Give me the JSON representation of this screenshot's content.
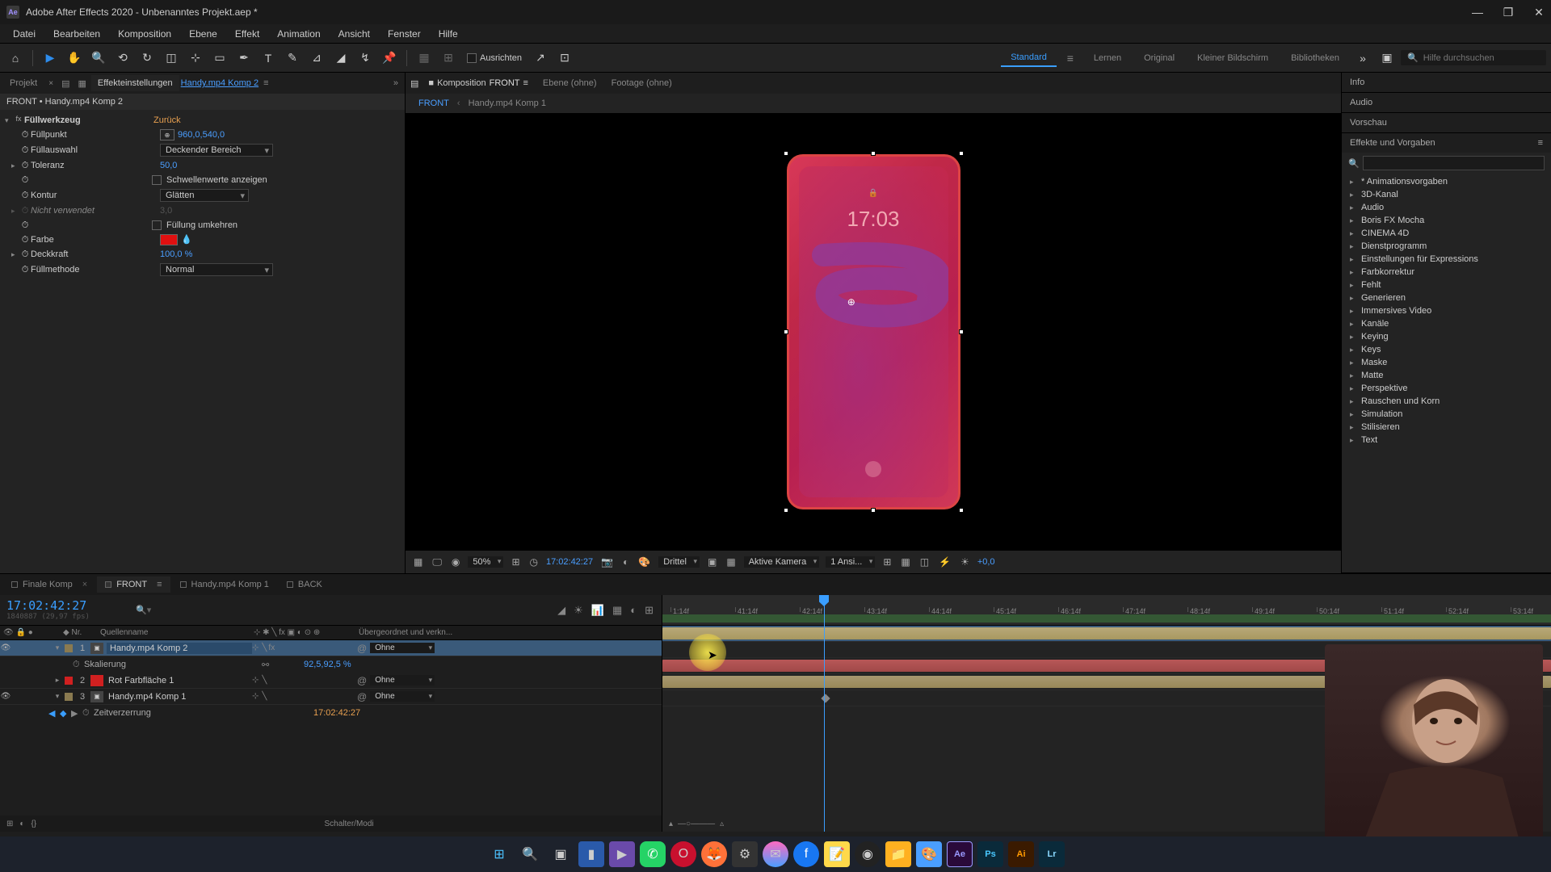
{
  "titlebar": {
    "app": "Adobe After Effects 2020",
    "project": "Unbenanntes Projekt.aep *"
  },
  "menu": [
    "Datei",
    "Bearbeiten",
    "Komposition",
    "Ebene",
    "Effekt",
    "Animation",
    "Ansicht",
    "Fenster",
    "Hilfe"
  ],
  "toolbar": {
    "align": "Ausrichten",
    "workspaces": [
      "Standard",
      "Lernen",
      "Original",
      "Kleiner Bildschirm",
      "Bibliotheken"
    ],
    "active_ws": "Standard",
    "search_placeholder": "Hilfe durchsuchen"
  },
  "left_panel": {
    "tabs": {
      "projekt": "Projekt",
      "settings": "Effekteinstellungen",
      "target": "Handy.mp4 Komp 2"
    },
    "breadcrumb": "FRONT • Handy.mp4 Komp 2",
    "effect_name": "Füllwerkzeug",
    "reset": "Zurück",
    "props": {
      "fuellpunkt": {
        "label": "Füllpunkt",
        "value": "960,0,540,0"
      },
      "fuellauswahl": {
        "label": "Füllauswahl",
        "value": "Deckender Bereich"
      },
      "toleranz": {
        "label": "Toleranz",
        "value": "50,0"
      },
      "schwellen": {
        "label": "Schwellenwerte anzeigen"
      },
      "kontur": {
        "label": "Kontur",
        "value": "Glätten"
      },
      "nicht": {
        "label": "Nicht verwendet",
        "value": "3,0"
      },
      "umkehren": {
        "label": "Füllung umkehren"
      },
      "farbe": {
        "label": "Farbe",
        "color": "#e01010"
      },
      "deckkraft": {
        "label": "Deckkraft",
        "value": "100,0 %"
      },
      "fuellmethode": {
        "label": "Füllmethode",
        "value": "Normal"
      }
    }
  },
  "composition": {
    "tabs": {
      "komp_prefix": "Komposition",
      "komp": "FRONT",
      "ebene": "Ebene (ohne)",
      "footage": "Footage (ohne)"
    },
    "breadcrumb": [
      "FRONT",
      "Handy.mp4 Komp 1"
    ],
    "phone": {
      "time": "17:03",
      "lock": "🔒"
    }
  },
  "viewer_footer": {
    "zoom": "50%",
    "timecode": "17:02:42:27",
    "res": "Drittel",
    "camera": "Aktive Kamera",
    "views": "1 Ansi...",
    "exposure": "+0,0"
  },
  "right": {
    "panels": [
      "Info",
      "Audio",
      "Vorschau"
    ],
    "effects_title": "Effekte und Vorgaben",
    "categories": [
      "* Animationsvorgaben",
      "3D-Kanal",
      "Audio",
      "Boris FX Mocha",
      "CINEMA 4D",
      "Dienstprogramm",
      "Einstellungen für Expressions",
      "Farbkorrektur",
      "Fehlt",
      "Generieren",
      "Immersives Video",
      "Kanäle",
      "Keying",
      "Keys",
      "Maske",
      "Matte",
      "Perspektive",
      "Rauschen und Korn",
      "Simulation",
      "Stilisieren",
      "Text"
    ]
  },
  "timeline": {
    "tabs": [
      "Finale Komp",
      "FRONT",
      "Handy.mp4 Komp 1",
      "BACK"
    ],
    "active_tab": "FRONT",
    "timecode": "17:02:42:27",
    "sub_tc": "1840887 (29,97 fps)",
    "col_nr": "Nr.",
    "col_name": "Quellenname",
    "col_parent": "Übergeordnet und verkn...",
    "ticks": [
      "1:14f",
      "41:14f",
      "42:14f",
      "43:14f",
      "44:14f",
      "45:14f",
      "46:14f",
      "47:14f",
      "48:14f",
      "49:14f",
      "50:14f",
      "51:14f",
      "52:14f",
      "53:14f"
    ],
    "layers": [
      {
        "num": "1",
        "name": "Handy.mp4 Komp 2",
        "color": "#8a7a50",
        "parent": "Ohne",
        "selected": true,
        "icon": "comp"
      },
      {
        "num": "2",
        "name": "Rot Farbfläche 1",
        "color": "#d02020",
        "parent": "Ohne",
        "icon": "solid",
        "hidden": true
      },
      {
        "num": "3",
        "name": "Handy.mp4 Komp 1",
        "color": "#8a7a50",
        "parent": "Ohne",
        "icon": "comp"
      }
    ],
    "sub1": {
      "name": "Skalierung",
      "value": "92,5,92,5 %"
    },
    "sub3": {
      "name": "Zeitverzerrung",
      "value": "17:02:42:27"
    },
    "footer": "Schalter/Modi"
  },
  "taskbar_icons": [
    "win",
    "search",
    "tasks",
    "explorer",
    "video",
    "whatsapp",
    "opera",
    "firefox",
    "app1",
    "messenger",
    "facebook",
    "notes",
    "obs",
    "folder",
    "paint",
    "ae",
    "ps",
    "ai",
    "lr"
  ]
}
